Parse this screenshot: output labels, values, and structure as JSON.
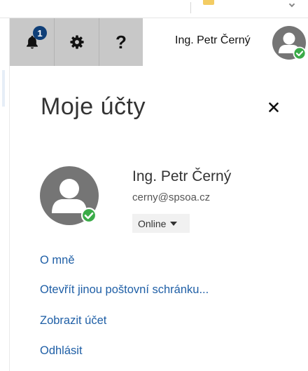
{
  "toolbar": {
    "notification_count": "1",
    "help_label": "?",
    "user_name": "Ing. Petr Černý"
  },
  "panel": {
    "title": "Moje účty",
    "close_label": "×",
    "profile": {
      "name": "Ing. Petr Černý",
      "email": "cerny@spsoa.cz",
      "status": "Online"
    },
    "links": [
      {
        "label": "O mně"
      },
      {
        "label": "Otevřít jinou poštovní schránku..."
      },
      {
        "label": "Zobrazit účet"
      },
      {
        "label": "Odhlásit"
      }
    ]
  },
  "colors": {
    "toolbar_button_bg": "#c8c8c8",
    "badge_bg": "#0f3f78",
    "link": "#1f5fa6",
    "online_status": "#3aab48",
    "avatar_bg": "#757575"
  },
  "icons": {
    "notifications": "bell-icon",
    "settings": "gear-icon",
    "help": "question-icon",
    "close": "close-icon",
    "status": "checkmark-icon",
    "avatar": "person-icon",
    "dropdown": "caret-down-icon"
  }
}
